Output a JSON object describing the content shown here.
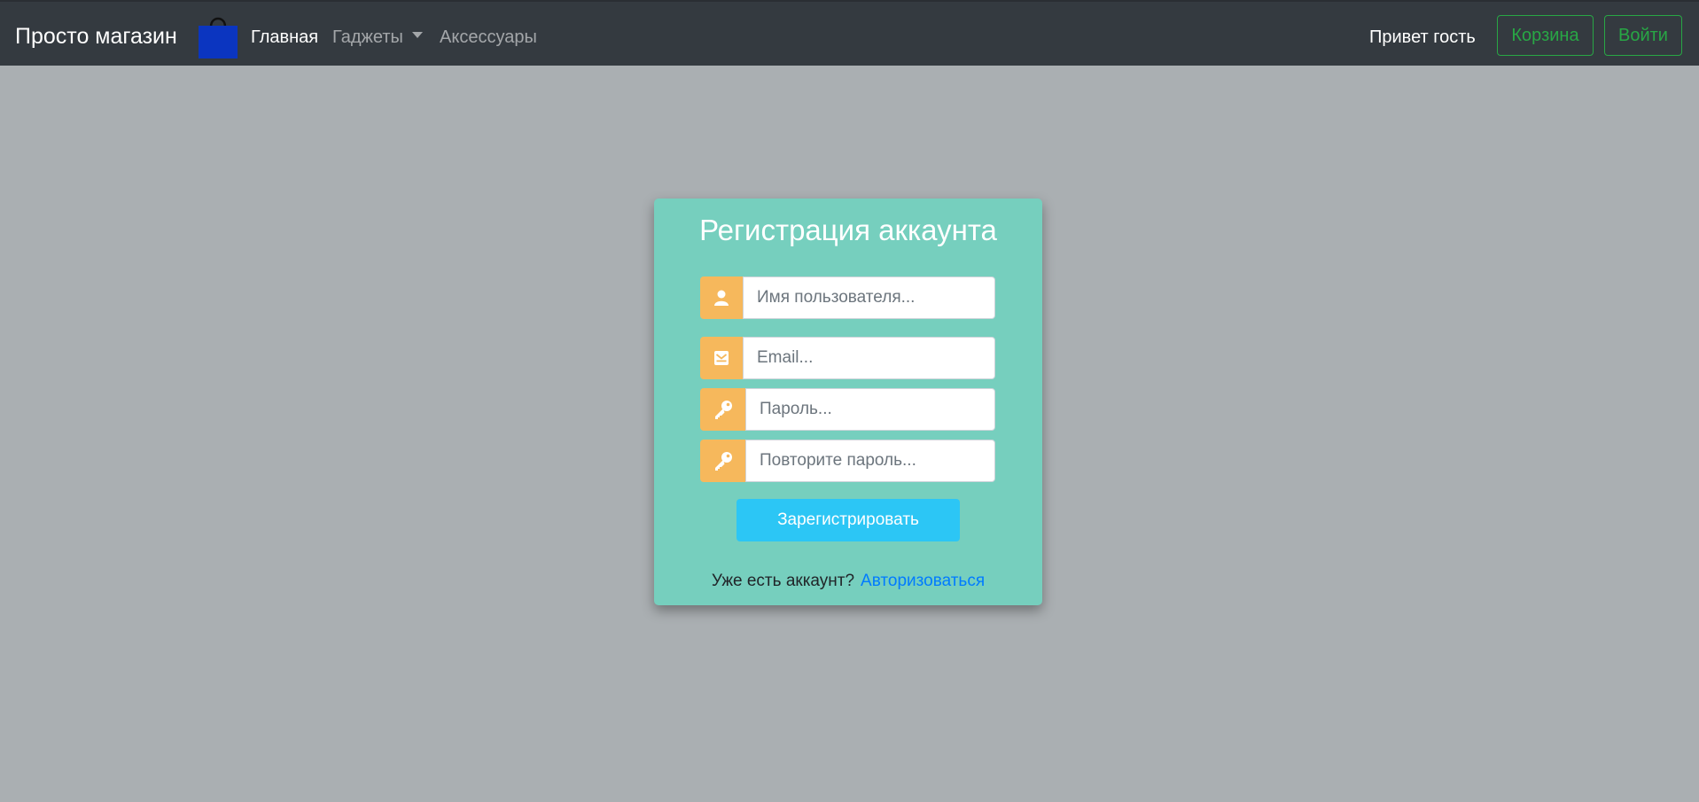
{
  "navbar": {
    "brand": "Просто магазин",
    "logo_icon": "shopping-bag-icon",
    "links": [
      {
        "label": "Главная",
        "active": true
      },
      {
        "label": "Гаджеты",
        "active": false,
        "dropdown": true
      },
      {
        "label": "Аксессуары",
        "active": false
      }
    ],
    "greeting": "Привет гость",
    "cart_button": "Корзина",
    "login_button": "Войти"
  },
  "colors": {
    "navbar_bg": "#343a40",
    "page_bg": "#aaafb2",
    "card_bg": "#76cfbe",
    "addon_bg": "#f6b85c",
    "submit_bg": "#2cc6f5",
    "outline_green": "#28a745",
    "link_blue": "#007bff",
    "bag_blue": "#0b35c0"
  },
  "form": {
    "title": "Регистрация аккаунта",
    "fields": [
      {
        "icon": "user-icon",
        "placeholder": "Имя пользователя..."
      },
      {
        "icon": "envelope-icon",
        "placeholder": "Email..."
      },
      {
        "icon": "key-icon",
        "placeholder": "Пароль..."
      },
      {
        "icon": "key-icon",
        "placeholder": "Повторите пароль..."
      }
    ],
    "submit_label": "Зарегистрировать",
    "footer_text": "Уже есть аккаунт?",
    "footer_link": "Авторизоваться"
  }
}
